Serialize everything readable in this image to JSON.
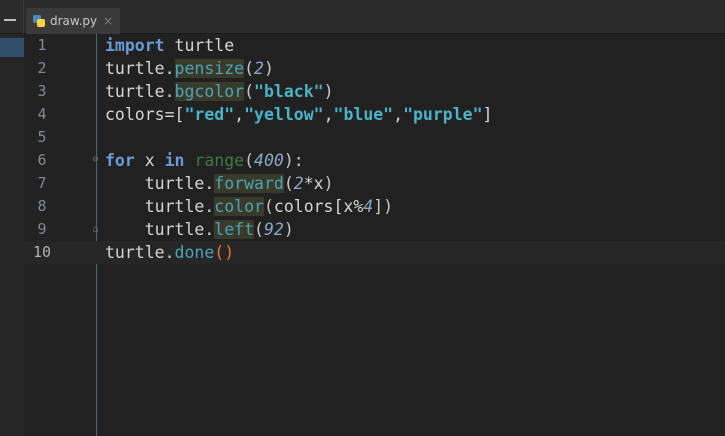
{
  "tab": {
    "filename": "draw.py",
    "close": "×"
  },
  "editor": {
    "current_line": 10,
    "lines": [
      {
        "num": "1",
        "kw": "import",
        "rest": " turtle"
      },
      {
        "num": "2",
        "obj": "turtle.",
        "method": "pensize",
        "open": "(",
        "arg": "2",
        "close": ")"
      },
      {
        "num": "3",
        "obj": "turtle.",
        "method": "bgcolor",
        "open": "(",
        "str": "\"black\"",
        "close": ")"
      },
      {
        "num": "4",
        "pre": "colors=[",
        "s1": "\"red\"",
        "c1": ",",
        "s2": "\"yellow\"",
        "c2": ",",
        "s3": "\"blue\"",
        "c3": ",",
        "s4": "\"purple\"",
        "post": "]"
      },
      {
        "num": "5"
      },
      {
        "num": "6",
        "kw1": "for",
        "mid1": " x ",
        "kw2": "in",
        "sp": " ",
        "builtin": "range",
        "open": "(",
        "arg": "400",
        "close": "):"
      },
      {
        "num": "7",
        "obj": "    turtle.",
        "method": "forward",
        "open": "(",
        "arg": "2",
        "rest": "*x",
        "close": ")"
      },
      {
        "num": "8",
        "obj": "    turtle.",
        "method": "color",
        "open": "(",
        "rest": "colors[x%",
        "arg": "4",
        "close": "])"
      },
      {
        "num": "9",
        "obj": "    turtle.",
        "method": "left",
        "open": "(",
        "arg": "92",
        "close": ")"
      },
      {
        "num": "10",
        "obj": "turtle.",
        "method": "done",
        "open": "(",
        "close": ")"
      }
    ]
  }
}
